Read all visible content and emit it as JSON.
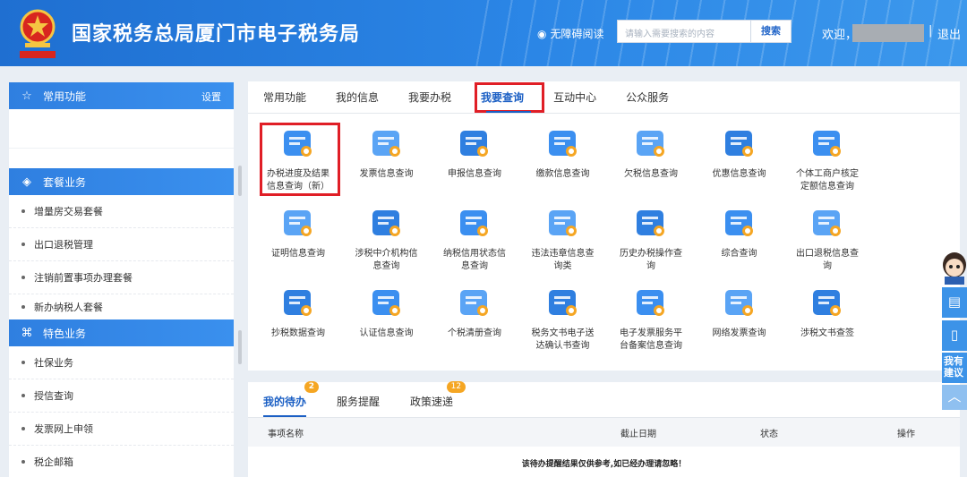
{
  "header": {
    "title": "国家税务总局厦门市电子税务局",
    "accessibility": "无障碍阅读",
    "search_placeholder": "请输入需要搜索的内容",
    "search_button": "搜索",
    "welcome": "欢迎，",
    "separator": "|",
    "logout": "退出"
  },
  "sidebar": {
    "common": {
      "label": "常用功能",
      "setting": "设置"
    },
    "package": {
      "label": "套餐业务",
      "items": [
        "增量房交易套餐",
        "出口退税管理",
        "注销前置事项办理套餐",
        "新办纳税人套餐"
      ]
    },
    "special": {
      "label": "特色业务",
      "items": [
        "社保业务",
        "授信查询",
        "发票网上申领",
        "税企邮箱"
      ]
    }
  },
  "main": {
    "tabs": [
      "常用功能",
      "我的信息",
      "我要办税",
      "我要查询",
      "互动中心",
      "公众服务"
    ],
    "active_tab": "我要查询",
    "items": [
      {
        "line1": "办税进度及结果",
        "line2": "信息查询（新）",
        "icon": "progress-query-icon"
      },
      {
        "line1": "发票信息查询",
        "line2": "",
        "icon": "invoice-query-icon"
      },
      {
        "line1": "申报信息查询",
        "line2": "",
        "icon": "declaration-query-icon"
      },
      {
        "line1": "缴款信息查询",
        "line2": "",
        "icon": "payment-query-icon"
      },
      {
        "line1": "欠税信息查询",
        "line2": "",
        "icon": "arrears-query-icon"
      },
      {
        "line1": "优惠信息查询",
        "line2": "",
        "icon": "discount-query-icon"
      },
      {
        "line1": "个体工商户核定",
        "line2": "定额信息查询",
        "icon": "individual-business-icon"
      },
      {
        "line1": "证明信息查询",
        "line2": "",
        "icon": "certificate-query-icon"
      },
      {
        "line1": "涉税中介机构信",
        "line2": "息查询",
        "icon": "agency-query-icon"
      },
      {
        "line1": "纳税信用状态信",
        "line2": "息查询",
        "icon": "credit-status-icon"
      },
      {
        "line1": "违法违章信息查",
        "line2": "询类",
        "icon": "violation-query-icon"
      },
      {
        "line1": "历史办税操作查",
        "line2": "询",
        "icon": "history-operation-icon"
      },
      {
        "line1": "综合查询",
        "line2": "",
        "icon": "comprehensive-query-icon"
      },
      {
        "line1": "出口退税信息查",
        "line2": "询",
        "icon": "export-rebate-query-icon"
      },
      {
        "line1": "抄税数据查询",
        "line2": "",
        "icon": "tax-copy-data-icon"
      },
      {
        "line1": "认证信息查询",
        "line2": "",
        "icon": "authentication-query-icon"
      },
      {
        "line1": "个税清册查询",
        "line2": "",
        "icon": "personal-tax-list-icon"
      },
      {
        "line1": "税务文书电子送",
        "line2": "达确认书查询",
        "icon": "tax-document-icon"
      },
      {
        "line1": "电子发票服务平",
        "line2": "台备案信息查询",
        "icon": "e-invoice-platform-icon"
      },
      {
        "line1": "网络发票查询",
        "line2": "",
        "icon": "network-invoice-icon"
      },
      {
        "line1": "涉税文书查签",
        "line2": "",
        "icon": "document-sign-icon"
      }
    ]
  },
  "bottom": {
    "tabs": [
      {
        "label": "我的待办",
        "badge": "2"
      },
      {
        "label": "服务提醒",
        "badge": ""
      },
      {
        "label": "政策速递",
        "badge": "12"
      }
    ],
    "columns": [
      "事项名称",
      "截止日期",
      "状态",
      "操作"
    ],
    "notice": "该待办提醒结果仅供参考,如已经办理请忽略！"
  },
  "float": {
    "feedback": "我有建议"
  },
  "colors": {
    "primary": "#1b5fc4",
    "highlight": "#e01e26",
    "badge": "#f5a623"
  }
}
